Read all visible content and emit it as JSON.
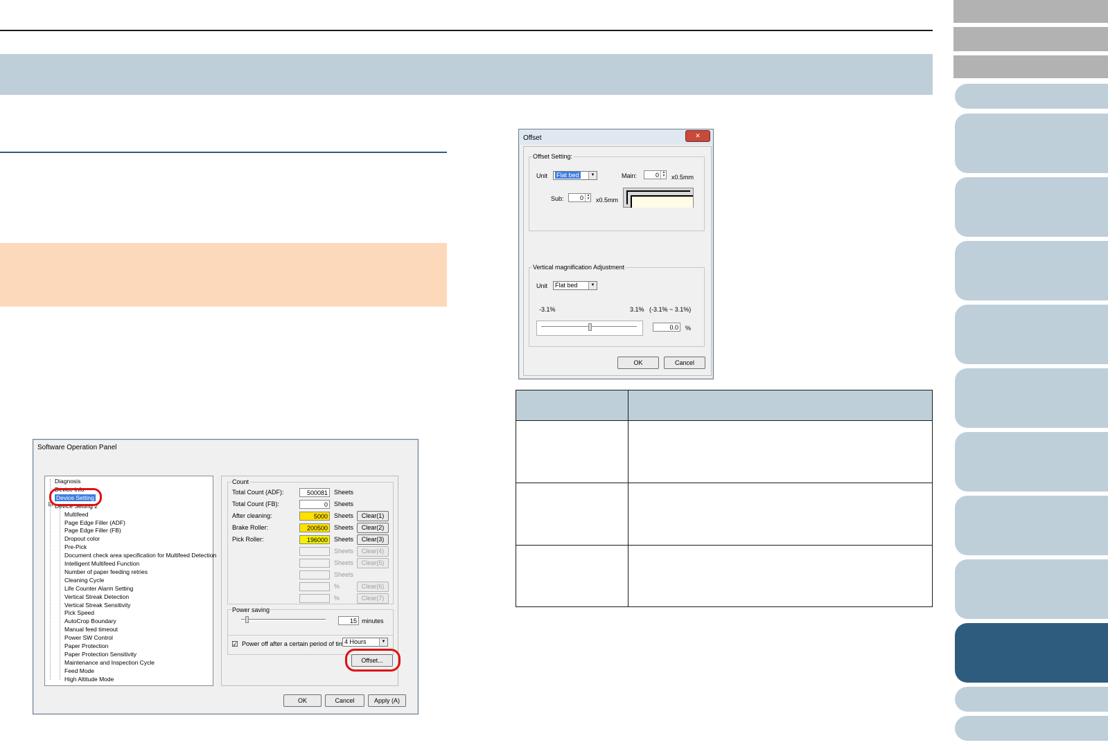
{
  "software_panel": {
    "title": "Software Operation Panel",
    "tree": [
      "Diagnosis",
      "Device Info",
      "Device Setting",
      "Device Setting 2",
      "Multifeed",
      "Page Edge Filler (ADF)",
      "Page Edge Filler (FB)",
      "Dropout color",
      "Pre-Pick",
      "Document check area specification for Multifeed Detection",
      "Intelligent Multifeed Function",
      "Number of paper feeding retries",
      "Cleaning Cycle",
      "Life Counter Alarm Setting",
      "Vertical Streak Detection",
      "Vertical Streak Sensitivity",
      "Pick Speed",
      "AutoCrop Boundary",
      "Manual feed timeout",
      "Power SW Control",
      "Paper Protection",
      "Paper Protection Sensitivity",
      "Maintenance and Inspection Cycle",
      "Feed Mode",
      "High Altitude Mode"
    ],
    "tree_expander": "⊟",
    "count_caption": "Count",
    "counters": [
      {
        "label": "Total Count (ADF):",
        "value": "500081",
        "unit": "Sheets",
        "button": ""
      },
      {
        "label": "Total Count (FB):",
        "value": "0",
        "unit": "Sheets",
        "button": ""
      },
      {
        "label": "After cleaning:",
        "value": "5000",
        "unit": "Sheets",
        "button": "Clear(1)"
      },
      {
        "label": "Brake Roller:",
        "value": "200500",
        "unit": "Sheets",
        "button": "Clear(2)"
      },
      {
        "label": "Pick Roller:",
        "value": "196000",
        "unit": "Sheets",
        "button": "Clear(3)"
      },
      {
        "label": "",
        "value": "",
        "unit": "Sheets",
        "button": "Clear(4)"
      },
      {
        "label": "",
        "value": "",
        "unit": "Sheets",
        "button": "Clear(5)"
      },
      {
        "label": "",
        "value": "",
        "unit": "Sheets",
        "button": ""
      },
      {
        "label": "",
        "value": "",
        "unit": "%",
        "button": "Clear(6)"
      },
      {
        "label": "",
        "value": "",
        "unit": "%",
        "button": "Clear(7)"
      }
    ],
    "power_caption": "Power saving",
    "power_value": "15",
    "power_unit": "minutes",
    "poweroff_check": "☑",
    "poweroff_label": "Power off after a certain period of time",
    "poweroff_select": "4 Hours",
    "offset_button": "Offset...",
    "ok": "OK",
    "cancel": "Cancel",
    "apply": "Apply (A)"
  },
  "offset_dialog": {
    "title": "Offset",
    "close": "✕",
    "offset_caption": "Offset Setting:",
    "unit_label": "Unit",
    "unit_value": "Flat bed",
    "main_label": "Main:",
    "main_value": "0",
    "main_unit": "x0.5mm",
    "sub_label": "Sub:",
    "sub_value": "0",
    "sub_unit": "x0.5mm",
    "vert_caption": "Vertical magnification Adjustment",
    "unit2_label": "Unit",
    "unit2_value": "Flat bed",
    "min_label": "-3.1%",
    "max_label": "3.1%",
    "range_label": "(-3.1% ~ 3.1%)",
    "slider_value": "0.0",
    "pct": "%",
    "ok": "OK",
    "cancel": "Cancel"
  },
  "colors": {
    "tab": "#bfcfd9",
    "tab_active": "#2d5c7f",
    "tab_gray": "#b2b2b2",
    "title_band": "#bfcfd9",
    "note_band": "#fdd9bb",
    "highlight": "#e01010"
  }
}
